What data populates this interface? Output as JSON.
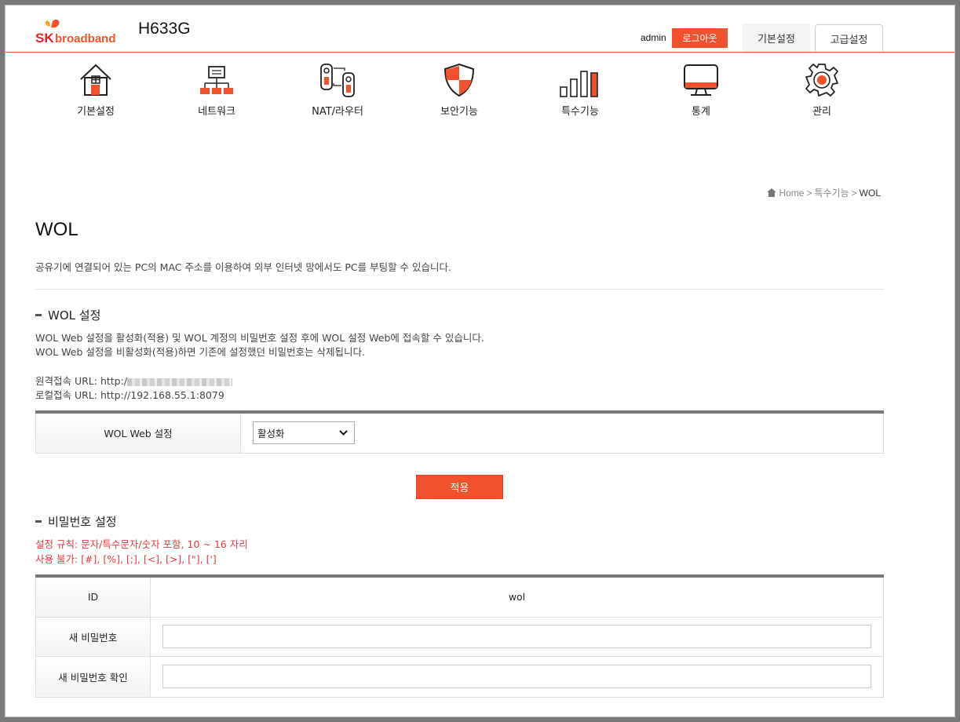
{
  "header": {
    "logo_text_sk": "SK",
    "logo_text_brand": "broadband",
    "model": "H633G",
    "user": "admin",
    "logout_label": "로그아웃",
    "tab_basic": "기본설정",
    "tab_advanced": "고급설정"
  },
  "menu": [
    {
      "label": "기본설정",
      "icon": "house-icon"
    },
    {
      "label": "네트워크",
      "icon": "network-icon"
    },
    {
      "label": "NAT/라우터",
      "icon": "router-icon"
    },
    {
      "label": "보안기능",
      "icon": "shield-icon"
    },
    {
      "label": "특수기능",
      "icon": "bars-icon"
    },
    {
      "label": "통계",
      "icon": "monitor-icon"
    },
    {
      "label": "관리",
      "icon": "gear-icon"
    }
  ],
  "breadcrumb": {
    "home": "Home",
    "sep1": ">",
    "parent": "특수기능",
    "sep2": ">",
    "current": "WOL"
  },
  "page": {
    "title": "WOL",
    "description": "공유기에 연결되어 있는 PC의 MAC 주소를 이용하여 외부 인터넷 망에서도 PC를 부팅할 수 있습니다."
  },
  "wol_section": {
    "heading": "WOL 설정",
    "line1": "WOL Web 설정을 활성화(적용) 및 WOL 계정의 비밀번호 설정 후에 WOL 설정 Web에 접속할 수 있습니다.",
    "line2": "WOL Web 설정을 비활성화(적용)하면 기존에 설정했던 비밀번호는 삭제됩니다.",
    "remote_url_label": "원격접속 URL: http:/",
    "local_url": "로컬접속 URL: http://192.168.55.1:8079",
    "setting_label": "WOL Web 설정",
    "setting_value": "활성화",
    "apply_label": "적용"
  },
  "password_section": {
    "heading": "비밀번호 설정",
    "rule": "설정 규칙: 문자/특수문자/숫자 포함, 10 ~ 16 자리",
    "forbidden": "사용 불가: [#], [%], [;], [<], [>], [\"], [']",
    "id_label": "ID",
    "id_value": "wol",
    "new_pw_label": "새 비밀번호",
    "new_pw_value": "",
    "confirm_pw_label": "새 비밀번호 확인",
    "confirm_pw_value": ""
  },
  "colors": {
    "accent": "#f2522b",
    "warn": "#e53b3b"
  }
}
